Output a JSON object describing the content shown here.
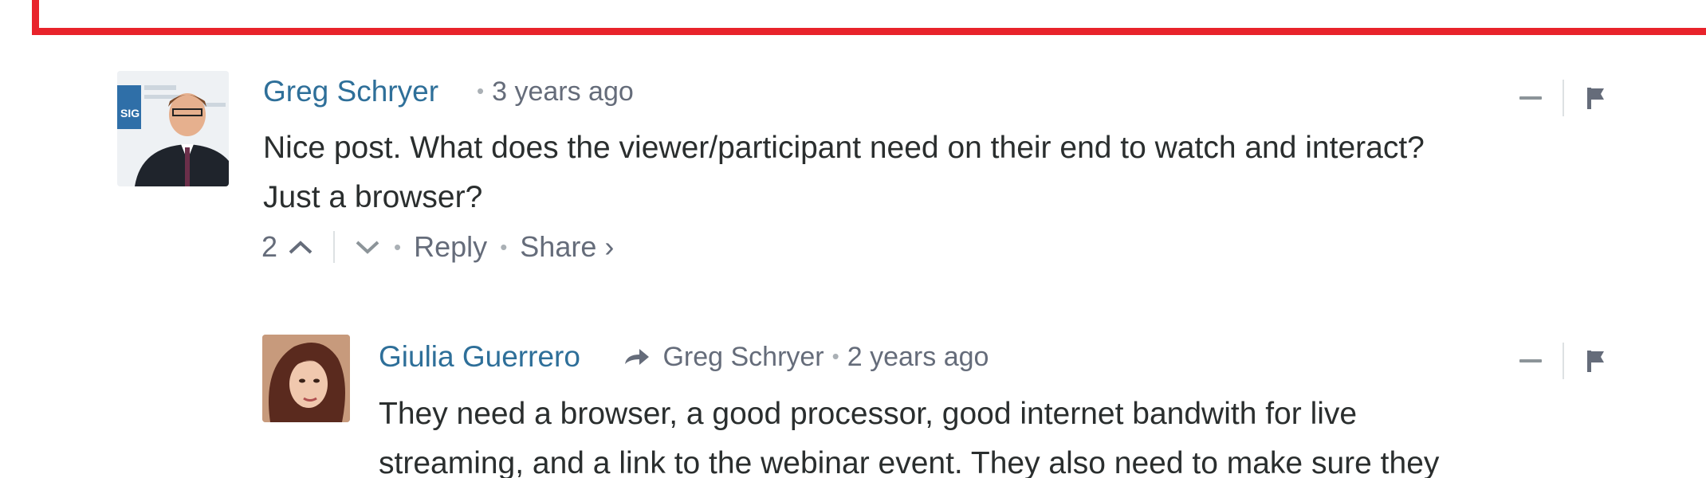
{
  "highlight": {
    "text": "· Share › Reply · Report"
  },
  "comments": [
    {
      "author": "Greg Schryer",
      "time": "3 years ago",
      "body_line1": "Nice post. What does the viewer/participant need on their end to watch and interact?",
      "body_line2": "Just a browser?",
      "votes": "2",
      "reply": "Reply",
      "share": "Share ›",
      "avatar_text": "SIG"
    },
    {
      "author": "Giulia Guerrero",
      "reply_to": "Greg Schryer",
      "time": "2 years ago",
      "body_line1": "They need a browser, a good processor, good internet bandwith for live",
      "body_line2": "streaming, and a link to the webinar event. They also need to make sure they"
    }
  ],
  "colors": {
    "author": "#2e6f99",
    "meta": "#656c7a",
    "highlight_border": "#e8232b"
  }
}
